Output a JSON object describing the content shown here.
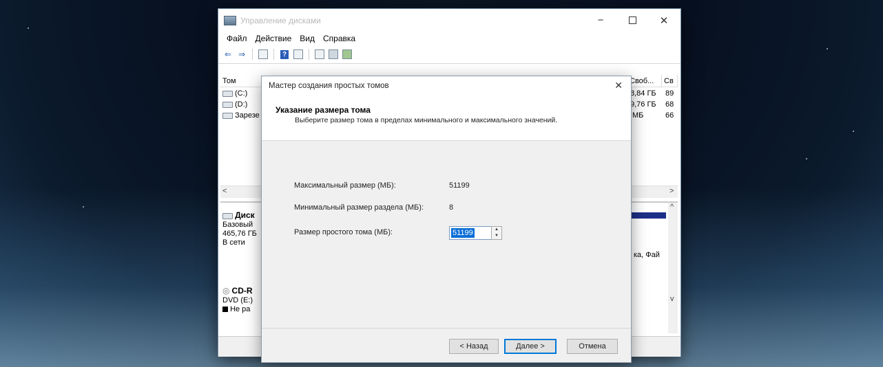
{
  "window": {
    "title": "Управление дисками",
    "controls": {
      "minimize": "−",
      "close": "✕"
    }
  },
  "menu": [
    "Файл",
    "Действие",
    "Вид",
    "Справка"
  ],
  "volumes": {
    "col_volume": "Том",
    "col_free": "Своб...",
    "col_pct": "Св",
    "rows": [
      {
        "name": "(C:)",
        "free": "8,84 ГБ",
        "pct": "89"
      },
      {
        "name": "(D:)",
        "free": "9,76 ГБ",
        "pct": "68"
      },
      {
        "name": "Зарезе",
        "free": "МБ",
        "pct": "66"
      }
    ]
  },
  "disks": {
    "disk0": {
      "title": "Диск",
      "type": "Базовый",
      "size": "465,76 ГБ",
      "status": "В сети"
    },
    "partition_text": "ка, Фай",
    "cdrom": {
      "title": "CD-R",
      "type": "DVD (E:)",
      "status": "Не ра"
    }
  },
  "wizard": {
    "title": "Мастер создания простых томов",
    "close": "✕",
    "heading": "Указание размера тома",
    "subheading": "Выберите размер тома в пределах минимального и максимального значений.",
    "max_label": "Максимальный размер (МБ):",
    "max_value": "51199",
    "min_label": "Минимальный размер раздела (МБ):",
    "min_value": "8",
    "size_label": "Размер простого тома (МБ):",
    "size_value": "51199",
    "back": "< Назад",
    "next": "Далее >",
    "cancel": "Отмена"
  },
  "colors": {
    "selection": "#0a6ed6",
    "disk_bar": "#1c2f88",
    "primary_border": "#0078d7"
  }
}
